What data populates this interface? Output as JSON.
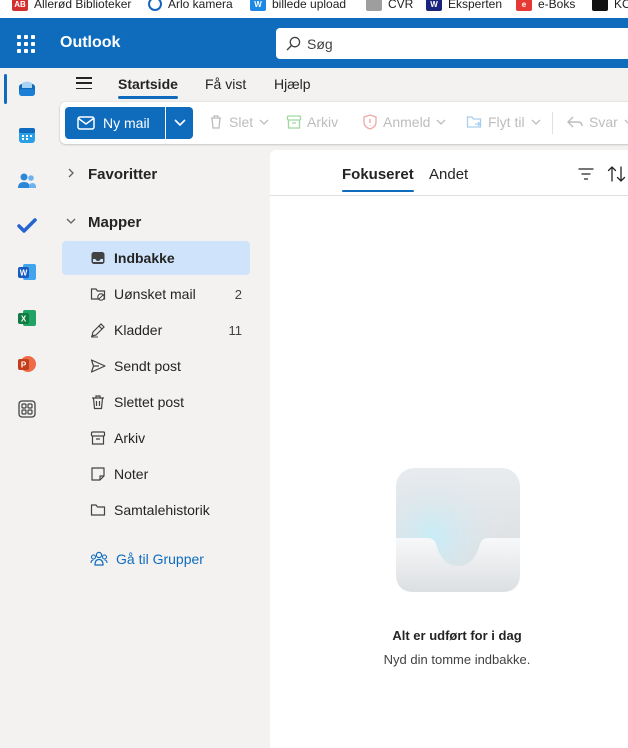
{
  "bookmarks": [
    {
      "label": "Allerød Biblioteker",
      "icon": "allerod-bookmark-icon",
      "color": "#d32f2f",
      "abbr": "AB"
    },
    {
      "label": "Arlo kamera",
      "icon": "arlo-bookmark-icon",
      "color": "#1565c0",
      "abbr": ""
    },
    {
      "label": "billede upload",
      "icon": "image-upload-bookmark-icon",
      "color": "#1e88e5",
      "abbr": "W"
    },
    {
      "label": "CVR",
      "icon": "cvr-bookmark-icon",
      "color": "#757575",
      "abbr": ""
    },
    {
      "label": "Eksperten",
      "icon": "eksperten-bookmark-icon",
      "color": "#1a237e",
      "abbr": "W"
    },
    {
      "label": "e-Boks",
      "icon": "eboks-bookmark-icon",
      "color": "#e53935",
      "abbr": "e"
    },
    {
      "label": "KO",
      "icon": "ko-bookmark-icon",
      "color": "#111111",
      "abbr": ""
    }
  ],
  "header": {
    "app_name": "Outlook",
    "search_placeholder": "Søg"
  },
  "ribbon": {
    "tabs": [
      {
        "label": "Startside",
        "active": true
      },
      {
        "label": "Få vist",
        "active": false
      },
      {
        "label": "Hjælp",
        "active": false
      }
    ]
  },
  "toolbar": {
    "new_mail": "Ny mail",
    "delete": "Slet",
    "archive": "Arkiv",
    "report": "Anmeld",
    "move_to": "Flyt til",
    "reply": "Svar"
  },
  "folders": {
    "favorites_label": "Favoritter",
    "folders_label": "Mapper",
    "items": [
      {
        "label": "Indbakke",
        "count": "",
        "icon": "inbox-icon",
        "selected": true
      },
      {
        "label": "Uønsket mail",
        "count": "2",
        "icon": "junk-mail-icon",
        "selected": false
      },
      {
        "label": "Kladder",
        "count": "11",
        "icon": "drafts-icon",
        "selected": false
      },
      {
        "label": "Sendt post",
        "count": "",
        "icon": "sent-icon",
        "selected": false
      },
      {
        "label": "Slettet post",
        "count": "",
        "icon": "deleted-icon",
        "selected": false
      },
      {
        "label": "Arkiv",
        "count": "",
        "icon": "archive-icon",
        "selected": false
      },
      {
        "label": "Noter",
        "count": "",
        "icon": "notes-icon",
        "selected": false
      },
      {
        "label": "Samtalehistorik",
        "count": "",
        "icon": "folder-icon",
        "selected": false
      }
    ],
    "groups_link": "Gå til Grupper"
  },
  "message_list": {
    "tabs": [
      {
        "label": "Fokuseret",
        "active": true
      },
      {
        "label": "Andet",
        "active": false
      }
    ],
    "empty_title": "Alt er udført for i dag",
    "empty_subtitle": "Nyd din tomme indbakke."
  },
  "colors": {
    "brand": "#0f6cbd",
    "selected_folder": "#cfe4fa"
  }
}
